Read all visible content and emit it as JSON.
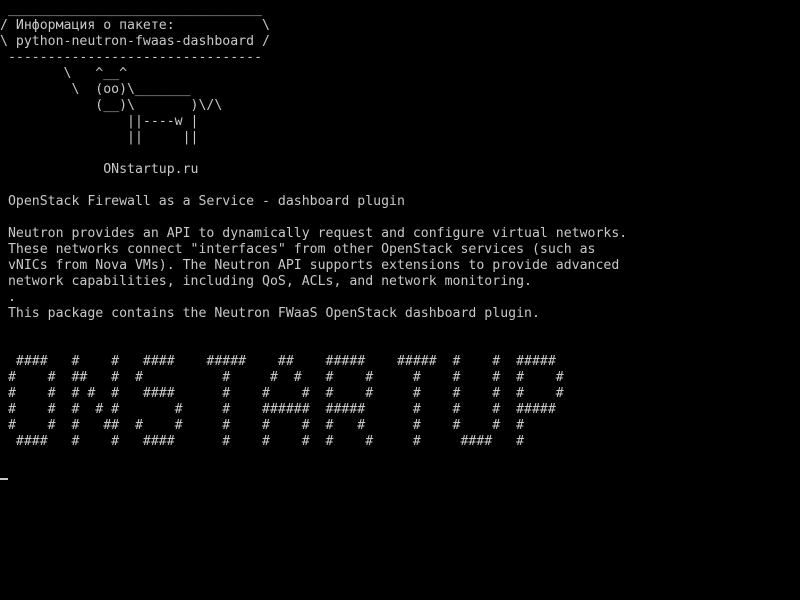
{
  "terminal": {
    "foreground_color": "#c8c8c8",
    "background_color": "#000000",
    "lines": [
      " ________________________________",
      "/ Информация о пакете:           \\",
      "\\ python-neutron-fwaas-dashboard /",
      " --------------------------------",
      "        \\   ^__^",
      "         \\  (oo)\\_______",
      "            (__)\\       )\\/\\",
      "                ||----w |",
      "                ||     ||",
      "",
      "             ONstartup.ru",
      "",
      " OpenStack Firewall as a Service - dashboard plugin",
      "",
      " Neutron provides an API to dynamically request and configure virtual networks.",
      " These networks connect \"interfaces\" from other OpenStack services (such as",
      " vNICs from Nova VMs). The Neutron API supports extensions to provide advanced",
      " network capabilities, including QoS, ACLs, and network monitoring.",
      " .",
      " This package contains the Neutron FWaaS OpenStack dashboard plugin.",
      "",
      "",
      "  ####   #    #   ####    #####    ##    #####    #####  #    #  #####",
      " #    #  ##   #  #          #     #  #   #    #     #    #    #  #    #",
      " #    #  # #  #   ####      #    #    #  #    #     #    #    #  #    #",
      " #    #  #  # #       #     #    ######  #####      #    #    #  #####",
      " #    #  #   ##  #    #     #    #    #  #   #      #    #    #  #",
      "  ####   #    #   ####      #    #    #  #    #     #     ####   #"
    ]
  }
}
